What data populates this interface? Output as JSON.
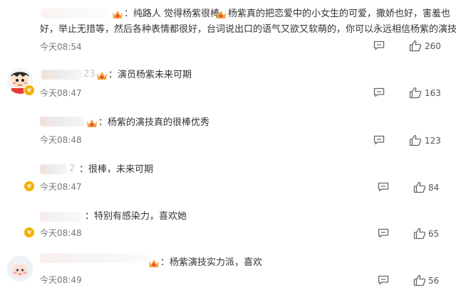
{
  "comments": [
    {
      "line1": "：纯路人 觉得杨紫很棒",
      "line1b": "杨紫真的把恋爱中的小女生的可爱，撒娇也好，害羞也",
      "line2": "好，举止无措等，然后各种表情都很好，台词说出口的语气又欲又软萌的，你可以永远相信杨紫的演技!",
      "time": "今天08:54",
      "likes": "260"
    },
    {
      "name_fragment": "23",
      "text": "：演员杨紫未来可期",
      "time": "今天08:47",
      "likes": "163"
    },
    {
      "text": "：杨紫的演技真的很棒优秀",
      "time": "今天08:48",
      "likes": "123"
    },
    {
      "name_fragment": "2",
      "text": "：很棒，未来可期",
      "time": "今天08:47",
      "likes": "84"
    },
    {
      "text": "：特别有感染力，喜欢她",
      "time": "今天08:48",
      "likes": "65"
    },
    {
      "text": "：杨紫演技实力派，喜欢",
      "time": "今天08:49",
      "likes": "56"
    }
  ],
  "icons": {
    "reply": "comment-reply-icon",
    "like": "thumbs-up-icon",
    "fan_badge": "fan-crown-badge-icon",
    "verified": "verified-v-badge-icon"
  },
  "colors": {
    "badge": "#f5b000",
    "text": "#333333",
    "meta": "#777777"
  }
}
